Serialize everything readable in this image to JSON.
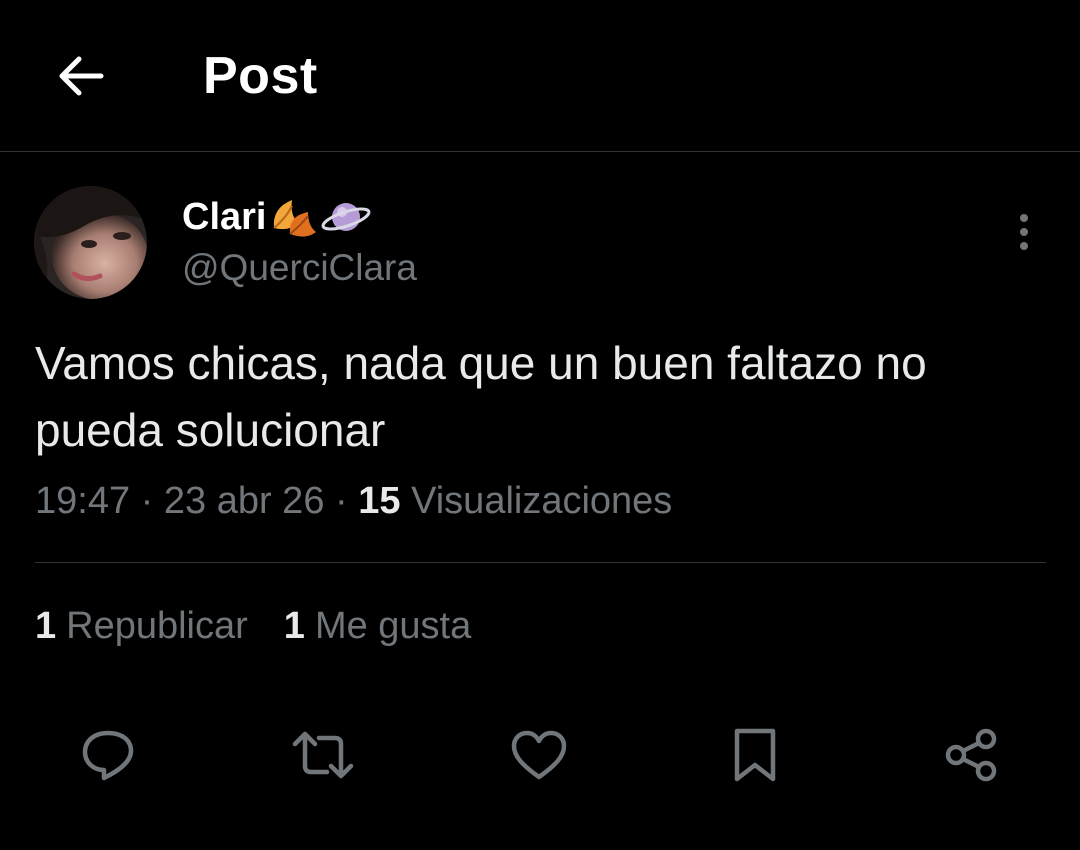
{
  "header": {
    "title": "Post",
    "back_icon": "arrow-left-icon"
  },
  "author": {
    "display_name": "Clari",
    "name_emojis": [
      "fallen-leaf-icon",
      "ringed-planet-icon"
    ],
    "handle": "@QuerciClara",
    "more_icon": "more-vertical-icon"
  },
  "post": {
    "text": "Vamos chicas, nada que un buen faltazo no pueda solucionar",
    "time": "19:47",
    "separator": " · ",
    "date": "23 abr 26",
    "views_count": "15",
    "views_label": "Visualizaciones"
  },
  "stats": {
    "reposts_count": "1",
    "reposts_label": "Republicar",
    "likes_count": "1",
    "likes_label": "Me gusta"
  },
  "actions": [
    {
      "name": "reply",
      "icon": "reply-icon"
    },
    {
      "name": "repost",
      "icon": "repost-icon"
    },
    {
      "name": "like",
      "icon": "heart-icon"
    },
    {
      "name": "bookmark",
      "icon": "bookmark-icon"
    },
    {
      "name": "share",
      "icon": "share-icon"
    }
  ],
  "colors": {
    "background": "#000000",
    "text_primary": "#e7e9ea",
    "text_secondary": "#71767b",
    "divider": "#2f3336",
    "icon": "#71767b"
  }
}
